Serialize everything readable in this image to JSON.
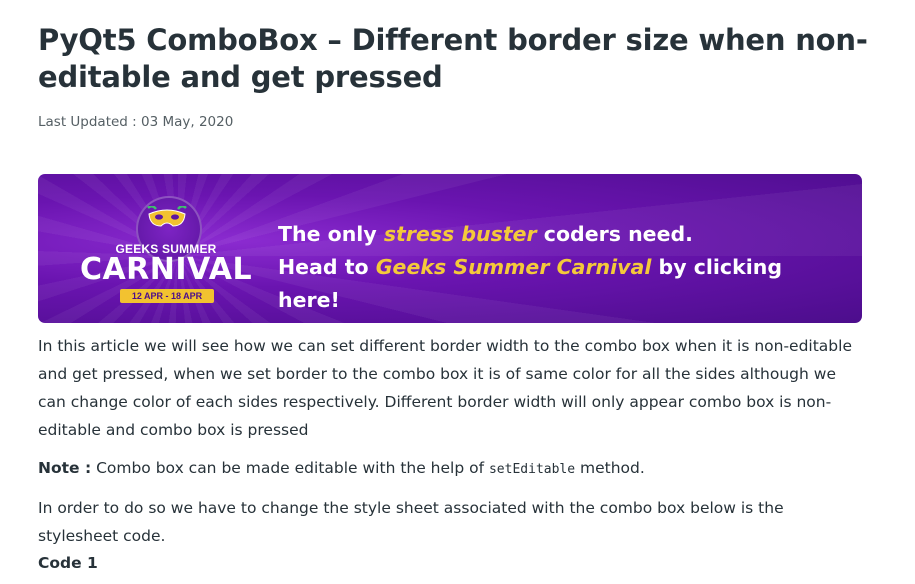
{
  "article": {
    "title": "PyQt5 ComboBox – Different border size when non-editable and get pressed",
    "last_updated": "Last Updated : 03 May, 2020"
  },
  "banner": {
    "badge_top": "GEEKS SUMMER",
    "badge_main": "CARNIVAL",
    "badge_dates": "12 APR - 18 APR",
    "line1_a": "The only ",
    "line1_em": "stress buster",
    "line1_b": " coders need.",
    "line2_a": "Head to ",
    "line2_em": "Geeks Summer Carnival",
    "line2_b": " by clicking here!",
    "colors": {
      "background": "#6a14b0",
      "highlight": "#f4c93a"
    }
  },
  "body": {
    "para1": "In this article we will see how we can set different border width to the combo box when it is non-editable and get pressed, when we set border to the combo box it is of same color for all the sides although we can change color of each sides respectively. Different border width will only appear combo box is non-editable and combo box is pressed",
    "note_label": "Note :",
    "note_text_a": " Combo box can be made editable with the help of ",
    "note_code": "setEditable",
    "note_text_b": " method.",
    "para3": "In order to do so we have to change the style sheet associated with the combo box below is the stylesheet code.",
    "code_title": "Code 1"
  }
}
